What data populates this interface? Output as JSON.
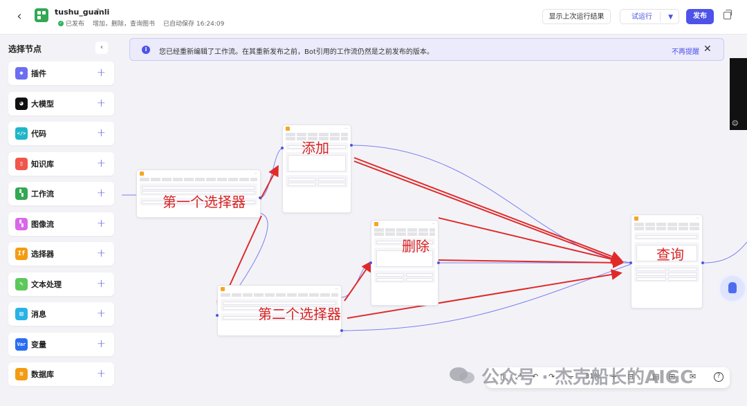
{
  "header": {
    "back_glyph": "‹",
    "app_title": "tushu_guanli",
    "status": "已发布",
    "description": "增加，删除，查询图书",
    "autosave": "已自动保存 16:24:09",
    "btn_last_run": "显示上次运行结果",
    "btn_trial_run": "试运行",
    "btn_publish": "发布"
  },
  "sidebar": {
    "title": "选择节点",
    "collapse_glyph": "‹",
    "items": [
      {
        "label": "插件",
        "icon": "plugin-icon",
        "color": "#6b6ef0",
        "glyph": "◆"
      },
      {
        "label": "大模型",
        "icon": "llm-icon",
        "color": "#111111",
        "glyph": "◕"
      },
      {
        "label": "代码",
        "icon": "code-icon",
        "color": "#1fb6c8",
        "glyph": "</>"
      },
      {
        "label": "知识库",
        "icon": "knowledge-icon",
        "color": "#f0564c",
        "glyph": "▯"
      },
      {
        "label": "工作流",
        "icon": "workflow-icon",
        "color": "#32a852",
        "glyph": "▚"
      },
      {
        "label": "图像流",
        "icon": "imageflow-icon",
        "color": "#d968e8",
        "glyph": "▚"
      },
      {
        "label": "选择器",
        "icon": "selector-icon",
        "color": "#f39c12",
        "glyph": "If"
      },
      {
        "label": "文本处理",
        "icon": "text-process-icon",
        "color": "#5cc85a",
        "glyph": "✎"
      },
      {
        "label": "消息",
        "icon": "message-icon",
        "color": "#27b3e6",
        "glyph": "▤"
      },
      {
        "label": "变量",
        "icon": "variable-icon",
        "color": "#2a6df0",
        "glyph": "Var"
      },
      {
        "label": "数据库",
        "icon": "database-icon",
        "color": "#f39c12",
        "glyph": "≋"
      }
    ],
    "plus_glyph": "+"
  },
  "banner": {
    "text": "您已经重新编辑了工作流。在其重新发布之前，Bot引用的工作流仍然是之前发布的版本。",
    "dismiss": "不再提醒",
    "close_glyph": "✕",
    "info_glyph": "i"
  },
  "annotations": {
    "add": "添加",
    "first_selector": "第一个选择器",
    "delete": "删除",
    "second_selector": "第二个选择器",
    "query": "查询"
  },
  "toolbar": {
    "zoom": "31%",
    "help_glyph": "?"
  },
  "watermark": "公众号 · 杰克船长的AIGC",
  "colors": {
    "accent": "#4d53e8",
    "annotation": "#d92222",
    "success": "#2fb35a"
  }
}
